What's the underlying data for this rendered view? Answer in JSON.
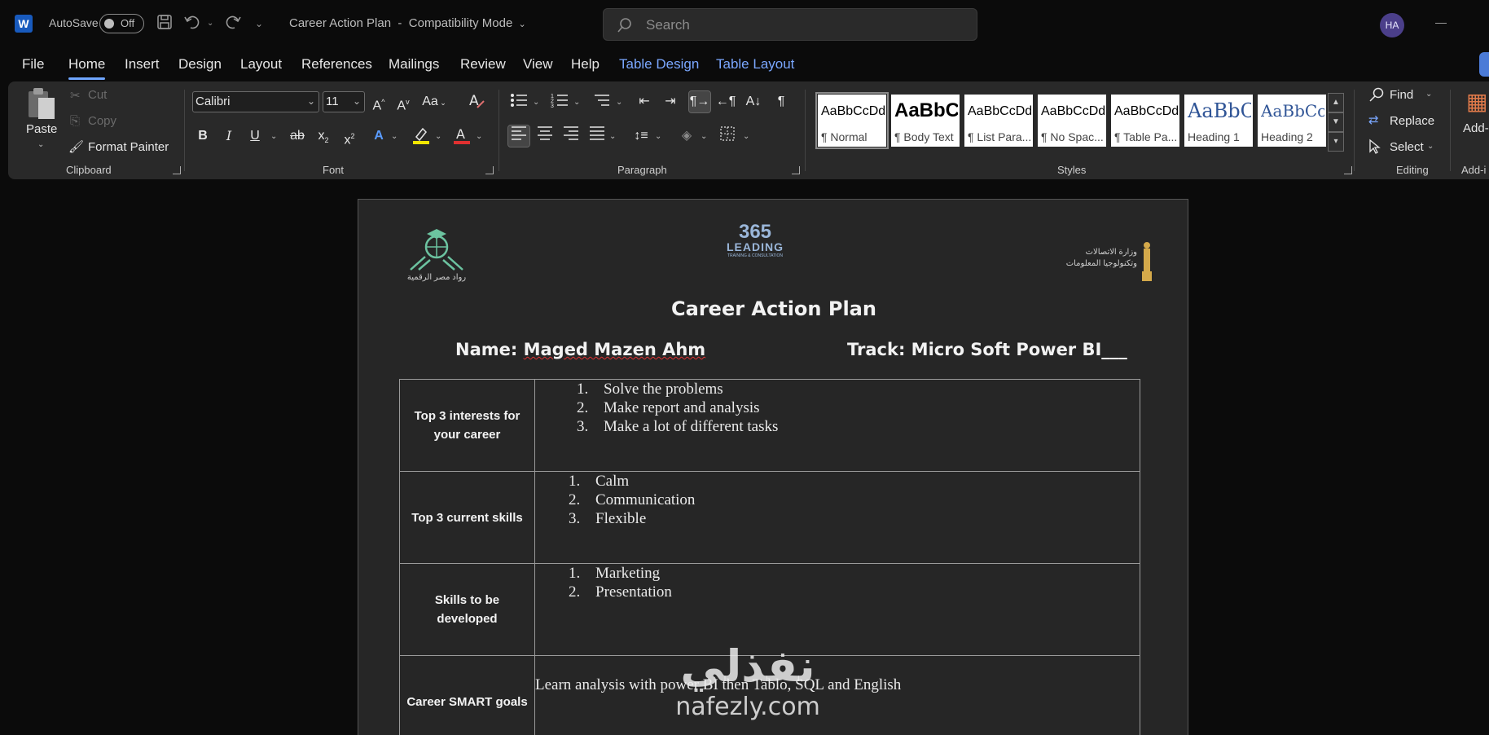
{
  "app": {
    "logo_letter": "W",
    "autosave_label": "AutoSave",
    "autosave_state": "Off",
    "doc_title": "Career Action Plan",
    "mode": "Compatibility Mode",
    "search_placeholder": "Search",
    "user_initials": "HA"
  },
  "tabs": [
    "File",
    "Home",
    "Insert",
    "Design",
    "Layout",
    "References",
    "Mailings",
    "Review",
    "View",
    "Help",
    "Table Design",
    "Table Layout"
  ],
  "active_tab": "Home",
  "ribbon": {
    "clipboard": {
      "label": "Clipboard",
      "paste": "Paste",
      "cut": "Cut",
      "copy": "Copy",
      "format_painter": "Format Painter"
    },
    "font": {
      "label": "Font",
      "font_name": "Calibri",
      "font_size": "11",
      "case_label": "Aa",
      "grow": "A",
      "shrink": "A"
    },
    "paragraph": {
      "label": "Paragraph"
    },
    "styles": {
      "label": "Styles",
      "items": [
        {
          "sample": "AaBbCcDd",
          "name": "¶ Normal"
        },
        {
          "sample": "AaBbC",
          "name": "¶ Body Text"
        },
        {
          "sample": "AaBbCcDd",
          "name": "¶ List Para..."
        },
        {
          "sample": "AaBbCcDd",
          "name": "¶ No Spac..."
        },
        {
          "sample": "AaBbCcDd",
          "name": "¶ Table Pa..."
        },
        {
          "sample": "AaBbC",
          "name": "Heading 1"
        },
        {
          "sample": "AaBbCc",
          "name": "Heading 2"
        }
      ]
    },
    "editing": {
      "label": "Editing",
      "find": "Find",
      "replace": "Replace",
      "select": "Select"
    },
    "addins": {
      "label": "Add-i",
      "button": "Add-i"
    }
  },
  "document": {
    "logos": {
      "left_caption": "رواد مصر الرقمية",
      "middle_number": "365",
      "middle_word": "LEADING",
      "middle_tag": "TRAINING & CONSULTATION",
      "right_line1": "وزارة الاتصالات",
      "right_line2": "وتكنولوجيا المعلومات"
    },
    "heading": "Career Action Plan",
    "name_label": "Name: ",
    "name_value": "Maged Mazen Ahm",
    "track_label": "Track: Micro Soft Power BI___",
    "rows": [
      {
        "label": "Top 3 interests for your career",
        "items": [
          "Solve the problems",
          "Make report and analysis",
          "Make a lot of different tasks"
        ]
      },
      {
        "label": "Top 3 current skills",
        "items": [
          "Calm",
          "Communication",
          "Flexible"
        ]
      },
      {
        "label": "Skills to be developed",
        "items": [
          "Marketing",
          "Presentation"
        ]
      },
      {
        "label": "Career SMART goals",
        "text": "Learn analysis with power BI then Tablo, SQL and English"
      }
    ]
  },
  "watermark": {
    "arabic": "نفذلي",
    "latin": "nafezly.com"
  },
  "colors": {
    "accent": "#6fa6ff",
    "context_tab": "#7aa7ff",
    "ribbon_bg": "#292929",
    "page_bg": "#262626"
  }
}
